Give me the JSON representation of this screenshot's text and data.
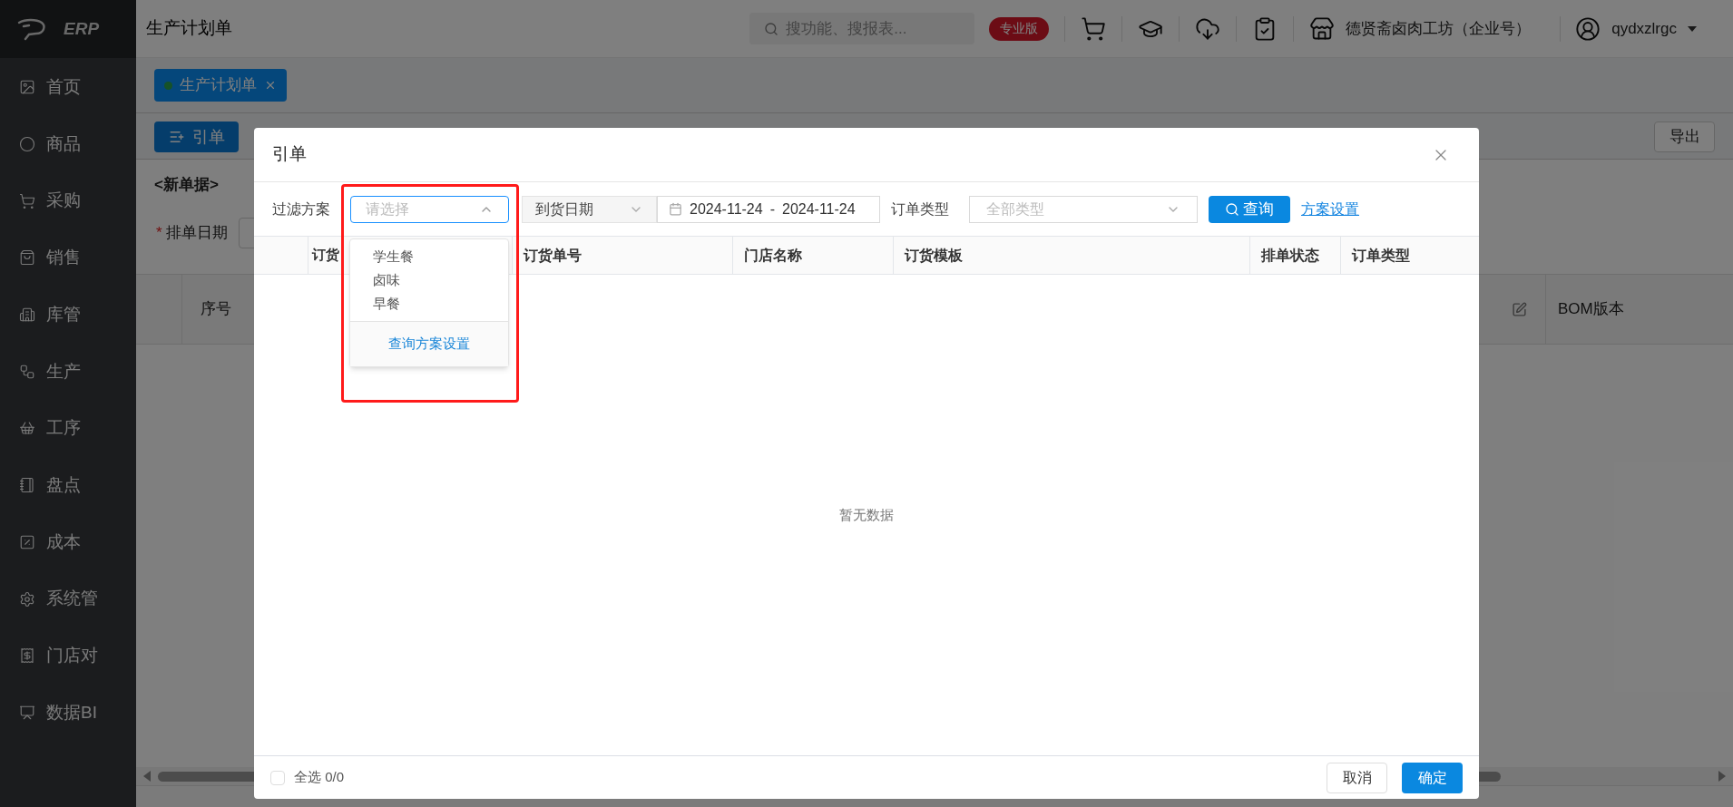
{
  "app": {
    "logo_text": "ERP",
    "page_title": "生产计划单"
  },
  "sidebar": {
    "items": [
      {
        "label": "首页"
      },
      {
        "label": "商品"
      },
      {
        "label": "采购"
      },
      {
        "label": "销售"
      },
      {
        "label": "库管"
      },
      {
        "label": "生产"
      },
      {
        "label": "工序"
      },
      {
        "label": "盘点"
      },
      {
        "label": "成本"
      },
      {
        "label": "系统管"
      },
      {
        "label": "门店对"
      },
      {
        "label": "数据BI"
      }
    ]
  },
  "header": {
    "search": {
      "placeholder": "搜功能、搜报表..."
    },
    "badge": "专业版",
    "company": "德贤斋卤肉工坊（企业号）",
    "user": "qydxzlrgc"
  },
  "tabs": [
    {
      "label": "生产计划单",
      "selected": true
    }
  ],
  "toolbar": {
    "import_button": "引单",
    "export_button": "导出"
  },
  "form": {
    "doc_label": "<新单据>",
    "date_label": "排单日期",
    "required": true,
    "required_mark": "*"
  },
  "grid": {
    "columns": [
      "序号",
      "BOM版本"
    ]
  },
  "dialog": {
    "title": "引单",
    "filter": {
      "label": "过滤方案",
      "placeholder": "请选择",
      "expanded": true,
      "options": [
        "学生餐",
        "卤味",
        "早餐"
      ],
      "settings_link": "查询方案设置"
    },
    "date_type": "到货日期",
    "date_from": "2024-11-24",
    "date_sep": "-",
    "date_to": "2024-11-24",
    "order_type": {
      "label": "订单类型",
      "placeholder": "全部类型"
    },
    "query_button": "查询",
    "scheme_link": "方案设置",
    "columns": [
      "订货",
      "订货单号",
      "门店名称",
      "订货模板",
      "排单状态",
      "订单类型"
    ],
    "empty_text": "暂无数据",
    "select_all": {
      "label": "全选 0/0",
      "checked": false
    },
    "cancel_button": "取消",
    "ok_button": "确定"
  }
}
